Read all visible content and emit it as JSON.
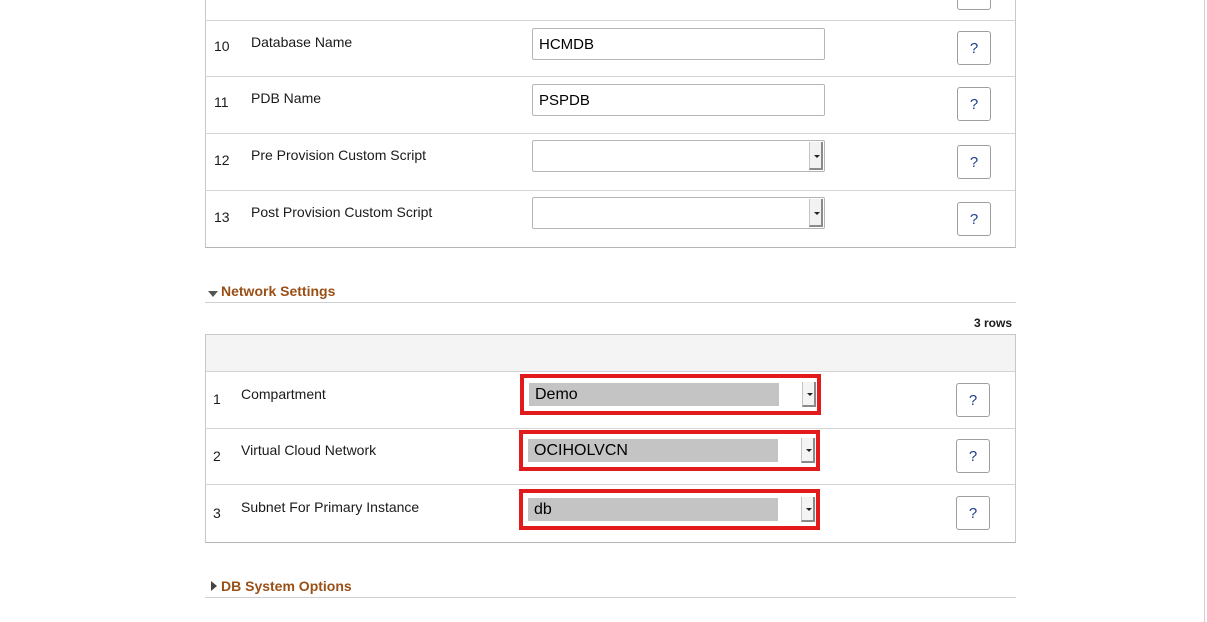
{
  "database_grid": {
    "rows": [
      {
        "num": "10",
        "label": "Database Name",
        "type": "text",
        "value": "HCMDB"
      },
      {
        "num": "11",
        "label": "PDB Name",
        "type": "text",
        "value": "PSPDB"
      },
      {
        "num": "12",
        "label": "Pre Provision Custom Script",
        "type": "select",
        "value": ""
      },
      {
        "num": "13",
        "label": "Post Provision Custom Script",
        "type": "select",
        "value": ""
      }
    ],
    "help_label": "?"
  },
  "network_settings": {
    "title": "Network Settings",
    "expanded": true,
    "row_count": "3 rows",
    "rows": [
      {
        "num": "1",
        "label": "Compartment",
        "value": "Demo",
        "highlighted": true
      },
      {
        "num": "2",
        "label": "Virtual Cloud Network",
        "value": "OCIHOLVCN",
        "highlighted": true
      },
      {
        "num": "3",
        "label": "Subnet For Primary Instance",
        "value": "db",
        "highlighted": true
      }
    ],
    "help_label": "?"
  },
  "db_system_options": {
    "title": "DB System Options",
    "expanded": false
  },
  "colors": {
    "section_title": "#9a4f17",
    "highlight_border": "#e11b1b",
    "help_text": "#1f3f8f"
  },
  "icons": {
    "section_expanded": "triangle-down-icon",
    "section_collapsed": "triangle-right-icon",
    "dropdown": "dropdown-arrow-icon"
  }
}
